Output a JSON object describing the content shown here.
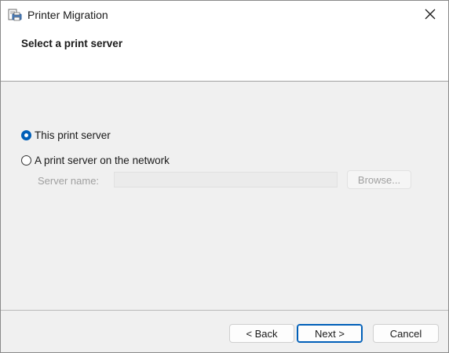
{
  "window": {
    "title": "Printer Migration",
    "close_icon": "close-icon",
    "app_icon": "printer-icon"
  },
  "header": {
    "title": "Select a print server"
  },
  "options": {
    "this_server": {
      "label": "This print server",
      "selected": true
    },
    "network_server": {
      "label": "A print server on the network",
      "selected": false
    }
  },
  "server_name": {
    "label": "Server name:",
    "value": "",
    "enabled": false
  },
  "buttons": {
    "browse": "Browse...",
    "back": "< Back",
    "next": "Next >",
    "cancel": "Cancel"
  },
  "colors": {
    "accent": "#005fb8",
    "disabled_text": "#a0a0a0",
    "background": "#f0f0f0"
  }
}
